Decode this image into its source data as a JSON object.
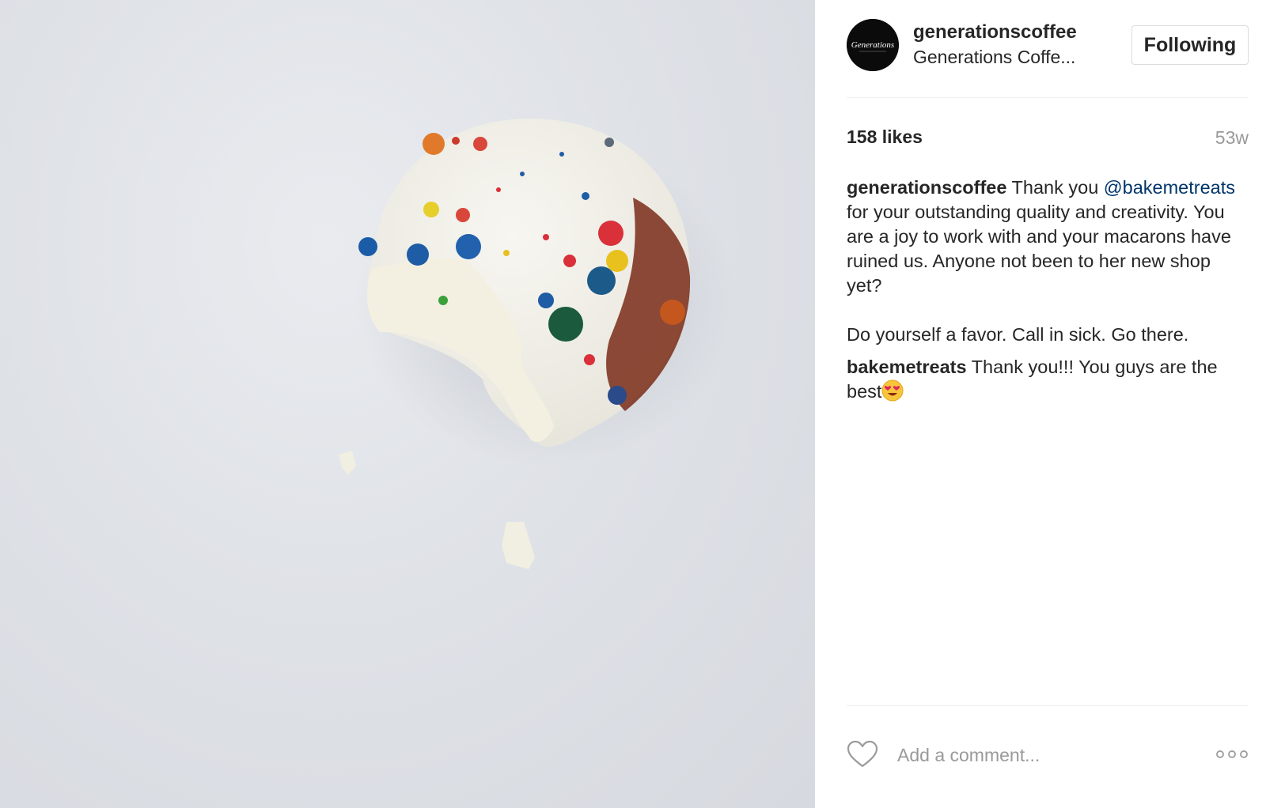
{
  "post": {
    "image": {
      "alt": "photo-macaron"
    },
    "header": {
      "username": "generationscoffee",
      "display_name": "Generations Coffe...",
      "follow_label": "Following",
      "avatar_text": "Generations"
    },
    "likes": "158 likes",
    "time_ago": "53w",
    "comments": [
      {
        "user": "generationscoffee",
        "text_before": " Thank you ",
        "mention": "@bakemetreats",
        "text_after": " for your outstanding quality and creativity. You are a joy to work with and your macarons have ruined us. Anyone not been to her new shop yet?\n\nDo yourself a favor. Call in sick. Go there."
      },
      {
        "user": "bakemetreats",
        "text": " Thank you!!! You guys are the best"
      }
    ],
    "comment_placeholder": "Add a comment..."
  },
  "icons": {
    "like": "heart-icon",
    "more": "more-options-icon",
    "emoji": "heart-eyes-emoji"
  },
  "colors": {
    "mention": "#003569",
    "muted": "#999999",
    "border": "#dbdbdb"
  }
}
